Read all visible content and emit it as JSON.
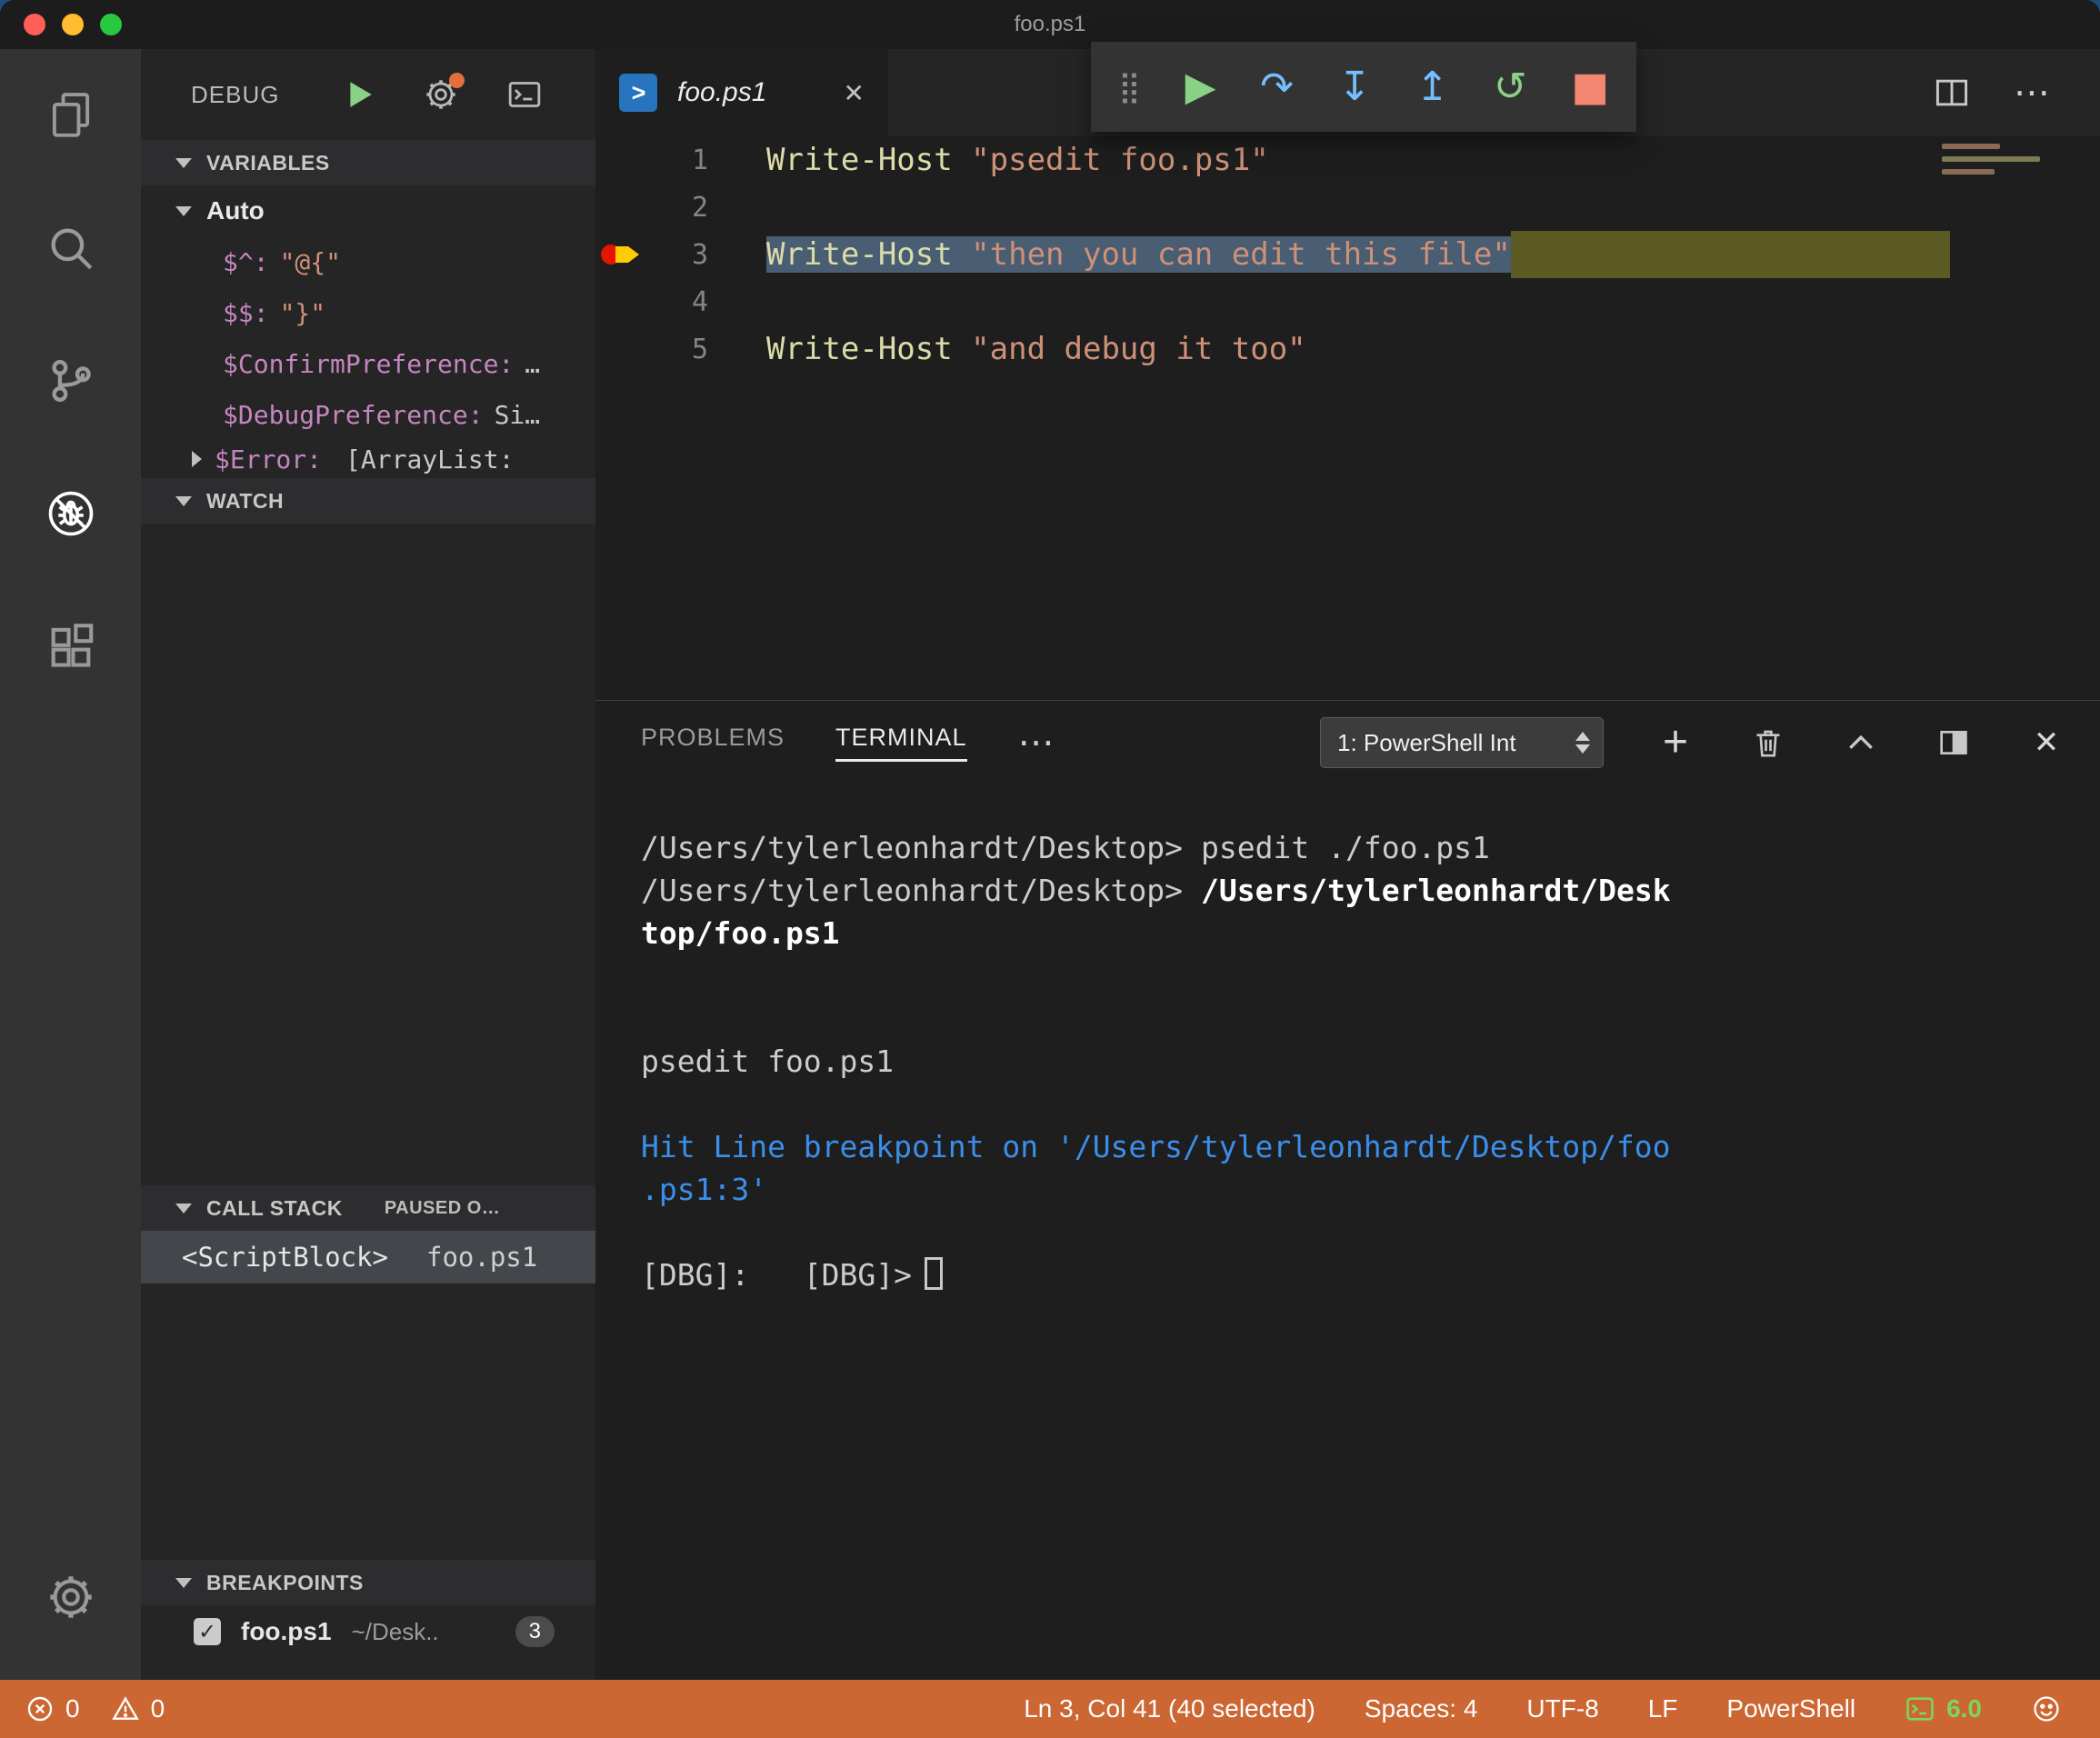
{
  "colors": {
    "status_bar": "#CC6633",
    "title_bar": "#1C1C1C",
    "activity_bar": "#333333",
    "sidebar": "#252526",
    "editor_bg": "#1E1E1E",
    "string": "#CE9178",
    "cmdlet": "#DCDCAA",
    "selection": "#495D73",
    "frame_highlight": "#5A5A22",
    "terminal_blue": "#3B8EEA",
    "debug_green": "#89D185",
    "debug_blue": "#75BEFF",
    "stop_red": "#F48771",
    "breakpoint_red": "#E51400",
    "arrow_yellow": "#FFCC00"
  },
  "icons": {
    "grip": "⣿",
    "continue": "▶",
    "step_over": "↷",
    "step_into": "↧",
    "step_out": "↥",
    "restart": "↺",
    "stop": "■",
    "close": "✕",
    "more": "⋯",
    "add": "+",
    "check": "✓",
    "ps_prompt": ">"
  },
  "window": {
    "title": "foo.ps1"
  },
  "sidebar": {
    "title": "DEBUG",
    "variables": {
      "header": "VARIABLES",
      "scope": "Auto",
      "items": [
        {
          "name": "$^:",
          "value": "\"@{\""
        },
        {
          "name": "$$:",
          "value": "\"}\""
        },
        {
          "name": "$ConfirmPreference:",
          "value": "…"
        },
        {
          "name": "$DebugPreference:",
          "value": "Si…"
        },
        {
          "name": "$Error:",
          "value": "[ArrayList:"
        }
      ]
    },
    "watch": {
      "header": "WATCH"
    },
    "call_stack": {
      "header": "CALL STACK",
      "status": "PAUSED O…",
      "frame": {
        "name": "<ScriptBlock>",
        "source": "foo.ps1"
      }
    },
    "breakpoints": {
      "header": "BREAKPOINTS",
      "item": {
        "file": "foo.ps1",
        "path": "~/Desk..",
        "line": "3"
      }
    }
  },
  "editor": {
    "tab": {
      "label": "foo.ps1"
    },
    "gutter": [
      "1",
      "2",
      "3",
      "4",
      "5"
    ],
    "lines": {
      "line1": {
        "cmdlet": "Write-Host ",
        "string": "\"psedit foo.ps1\""
      },
      "line3": {
        "cmdlet": "Write-Host ",
        "string": "\"then you can edit this file\""
      },
      "line5": {
        "cmdlet": "Write-Host ",
        "string": "\"and debug it too\""
      }
    }
  },
  "panel": {
    "tabs": {
      "problems": "PROBLEMS",
      "terminal": "TERMINAL"
    },
    "terminal_select": "1: PowerShell Int",
    "terminal": {
      "prompt": "/Users/tylerleonhardt/Desktop>",
      "command1": "psedit ./foo.ps1",
      "command2": "/Users/tylerleonhardt/Desk",
      "command2_wrap": "top/foo.ps1",
      "echo": "psedit foo.ps1",
      "break_msg1": "Hit Line breakpoint on '/Users/tylerleonhardt/Desktop/foo",
      "break_msg2": ".ps1:3'",
      "dbg_prompt": "[DBG]:   [DBG]>"
    }
  },
  "status_bar": {
    "errors": "0",
    "warnings": "0",
    "cursor": "Ln 3, Col 41 (40 selected)",
    "indent": "Spaces: 4",
    "encoding": "UTF-8",
    "eol": "LF",
    "language": "PowerShell",
    "ps_version": "6.0"
  }
}
